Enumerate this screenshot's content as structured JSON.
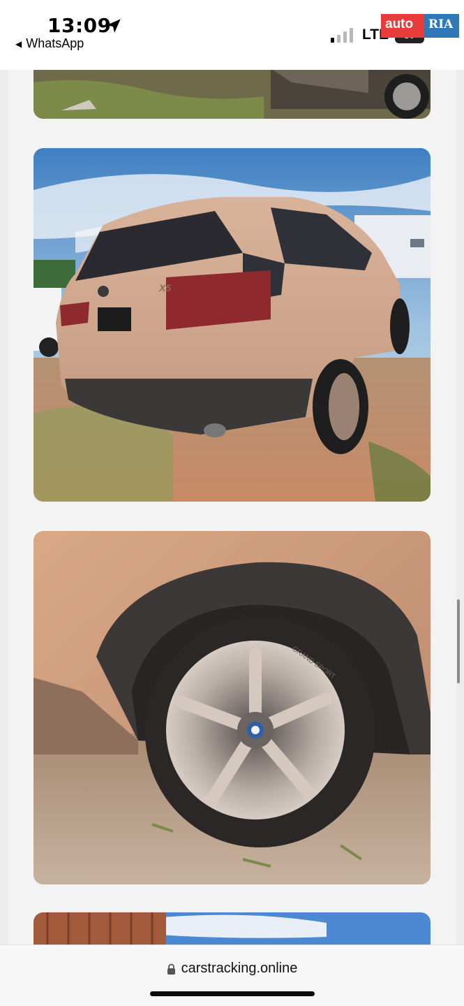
{
  "status_bar": {
    "time": "13:09",
    "back_label": "WhatsApp",
    "network": "LTE",
    "battery": "57"
  },
  "watermark": {
    "brand_left": "auto",
    "brand_right": "RIA"
  },
  "icons": {
    "location": "location-arrow-icon",
    "signal": "cellular-signal-icon",
    "lock": "lock-icon",
    "back": "back-arrow-icon"
  },
  "gallery": {
    "photos": [
      {
        "subject": "car-side-partial"
      },
      {
        "subject": "suv-rear",
        "badge": "X5"
      },
      {
        "subject": "wheel-closeup",
        "tire_text": "GRAND SPORT"
      },
      {
        "subject": "containers-partial"
      }
    ]
  },
  "browser": {
    "url": "carstracking.online"
  }
}
